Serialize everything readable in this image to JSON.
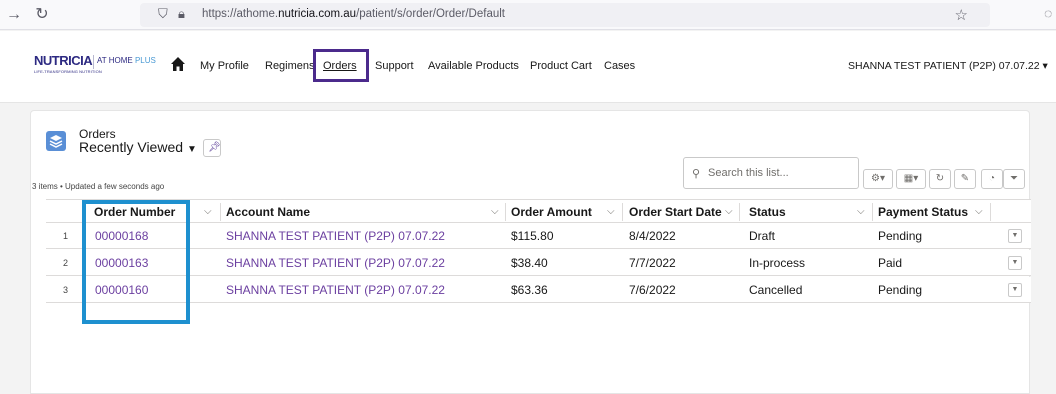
{
  "browser": {
    "url_prefix": "https://athome.",
    "url_domain": "nutricia.com.au",
    "url_path": "/patient/s/order/Order/Default"
  },
  "header": {
    "logo_main": "NUTRICIA",
    "logo_sub": "LIFE-TRANSFORMING NUTRITION",
    "logo_at": "AT HOME",
    "logo_plus": "PLUS",
    "nav": [
      "My Profile",
      "Regimens",
      "Orders",
      "Support",
      "Available Products",
      "Product Cart",
      "Cases"
    ],
    "user": "SHANNA TEST PATIENT (P2P) 07.07.22 ▾"
  },
  "list": {
    "object_label": "Orders",
    "view_name": "Recently Viewed",
    "info": "3 items • Updated a few seconds ago",
    "search_placeholder": "Search this list...",
    "columns": [
      "Order Number",
      "Account Name",
      "Order Amount",
      "Order Start Date",
      "Status",
      "Payment Status"
    ],
    "rows": [
      {
        "num": "1",
        "order": "00000168",
        "account": "SHANNA TEST PATIENT (P2P) 07.07.22",
        "amount": "$115.80",
        "date": "8/4/2022",
        "status": "Draft",
        "payment": "Pending"
      },
      {
        "num": "2",
        "order": "00000163",
        "account": "SHANNA TEST PATIENT (P2P) 07.07.22",
        "amount": "$38.40",
        "date": "7/7/2022",
        "status": "In-process",
        "payment": "Paid"
      },
      {
        "num": "3",
        "order": "00000160",
        "account": "SHANNA TEST PATIENT (P2P) 07.07.22",
        "amount": "$63.36",
        "date": "7/6/2022",
        "status": "Cancelled",
        "payment": "Pending"
      }
    ]
  },
  "colors": {
    "brand": "#2d2a82",
    "nav_highlight": "#4b2a8c",
    "link": "#6b3fa0",
    "annotation": "#1e90cf"
  }
}
